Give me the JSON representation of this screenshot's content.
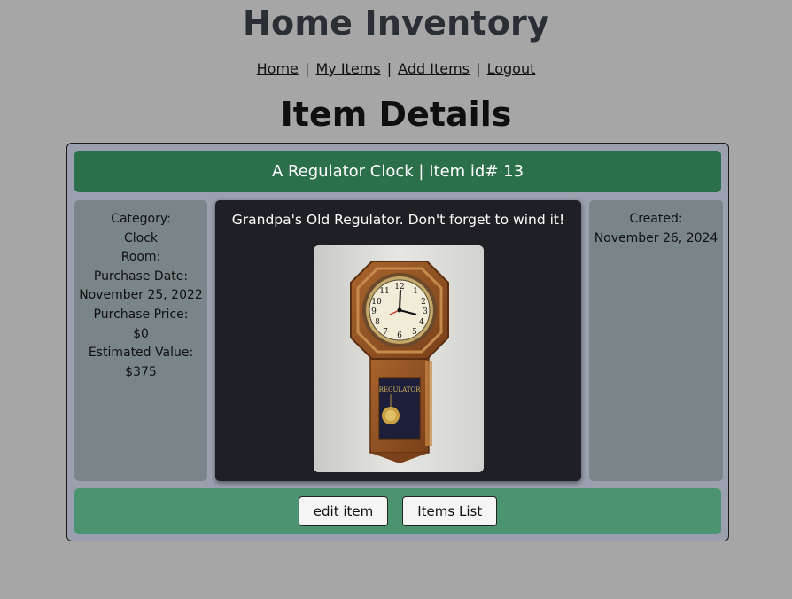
{
  "site": {
    "title": "Home Inventory"
  },
  "nav": {
    "items": [
      "Home",
      "My Items",
      "Add Items",
      "Logout"
    ],
    "separator": "|"
  },
  "page": {
    "title": "Item Details"
  },
  "item": {
    "header": "A Regulator Clock | Item id# 13",
    "category_label": "Category:",
    "category": "Clock",
    "room_label": "Room:",
    "room": "",
    "purchase_date_label": "Purchase Date:",
    "purchase_date": "November 25, 2022",
    "purchase_price_label": "Purchase Price:",
    "purchase_price": "$0",
    "estimated_value_label": "Estimated Value:",
    "estimated_value": "$375",
    "description": "Grandpa's Old Regulator. Don't forget to wind it!",
    "created_label": "Created:",
    "created": "November 26, 2024",
    "photo_text": "REGULATOR"
  },
  "buttons": {
    "edit": "edit item",
    "list": "Items List"
  },
  "colors": {
    "page_bg": "#a6a6a6",
    "header_green": "#2c6f4b",
    "footer_green": "#4c9470",
    "side_panel": "#798589",
    "center_panel": "#1f1f26"
  }
}
